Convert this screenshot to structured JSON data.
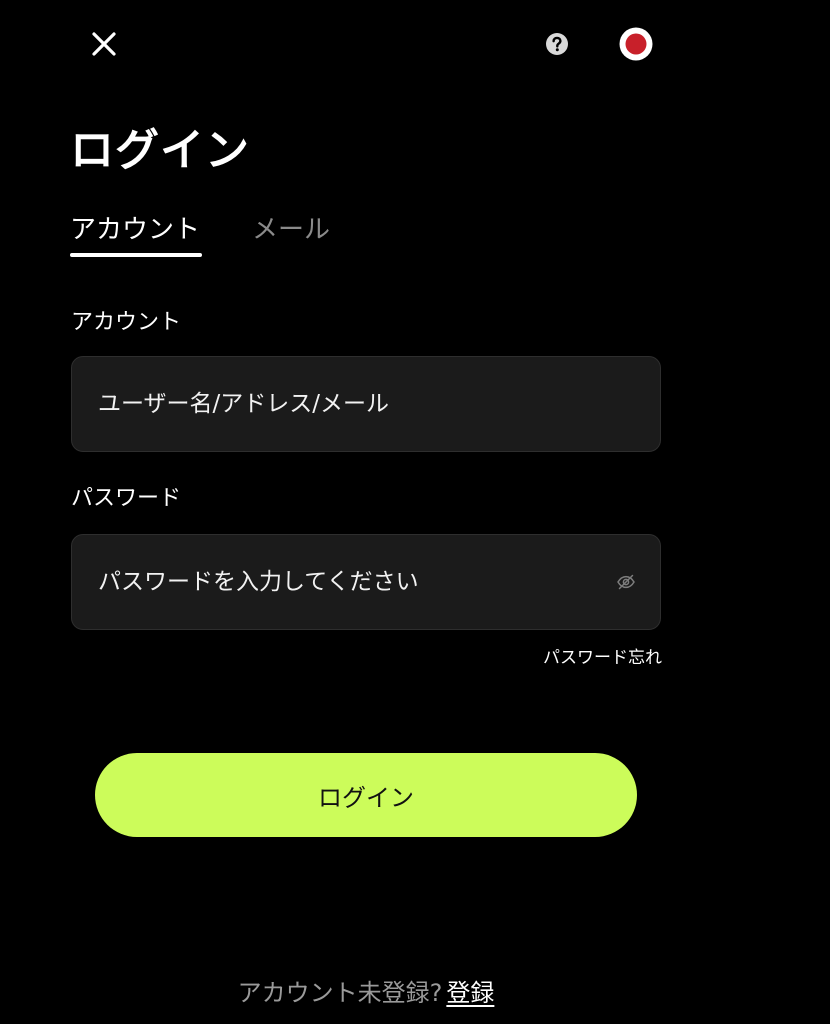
{
  "header": {
    "close_icon": "close-icon",
    "help_icon": "question-circle-icon",
    "language_icon": "japan-flag-icon",
    "flag_colors": {
      "field": "#ffffff",
      "circle": "#c8202a"
    }
  },
  "title": "ログイン",
  "tabs": [
    {
      "label": "アカウント",
      "active": true
    },
    {
      "label": "メール",
      "active": false
    }
  ],
  "form": {
    "account": {
      "label": "アカウント",
      "placeholder": "ユーザー名/アドレス/メール",
      "value": ""
    },
    "password": {
      "label": "パスワード",
      "placeholder": "パスワードを入力してください",
      "value": "",
      "toggle_icon": "eye-slash-icon"
    },
    "forgot_label": "パスワード忘れ"
  },
  "login_button_label": "ログイン",
  "footer": {
    "prompt": "アカウント未登録?",
    "register_label": "登録"
  },
  "colors": {
    "background": "#000000",
    "input_background": "#1b1b1b",
    "accent": "#ccfc5a",
    "muted_text": "#8a8a8a"
  }
}
